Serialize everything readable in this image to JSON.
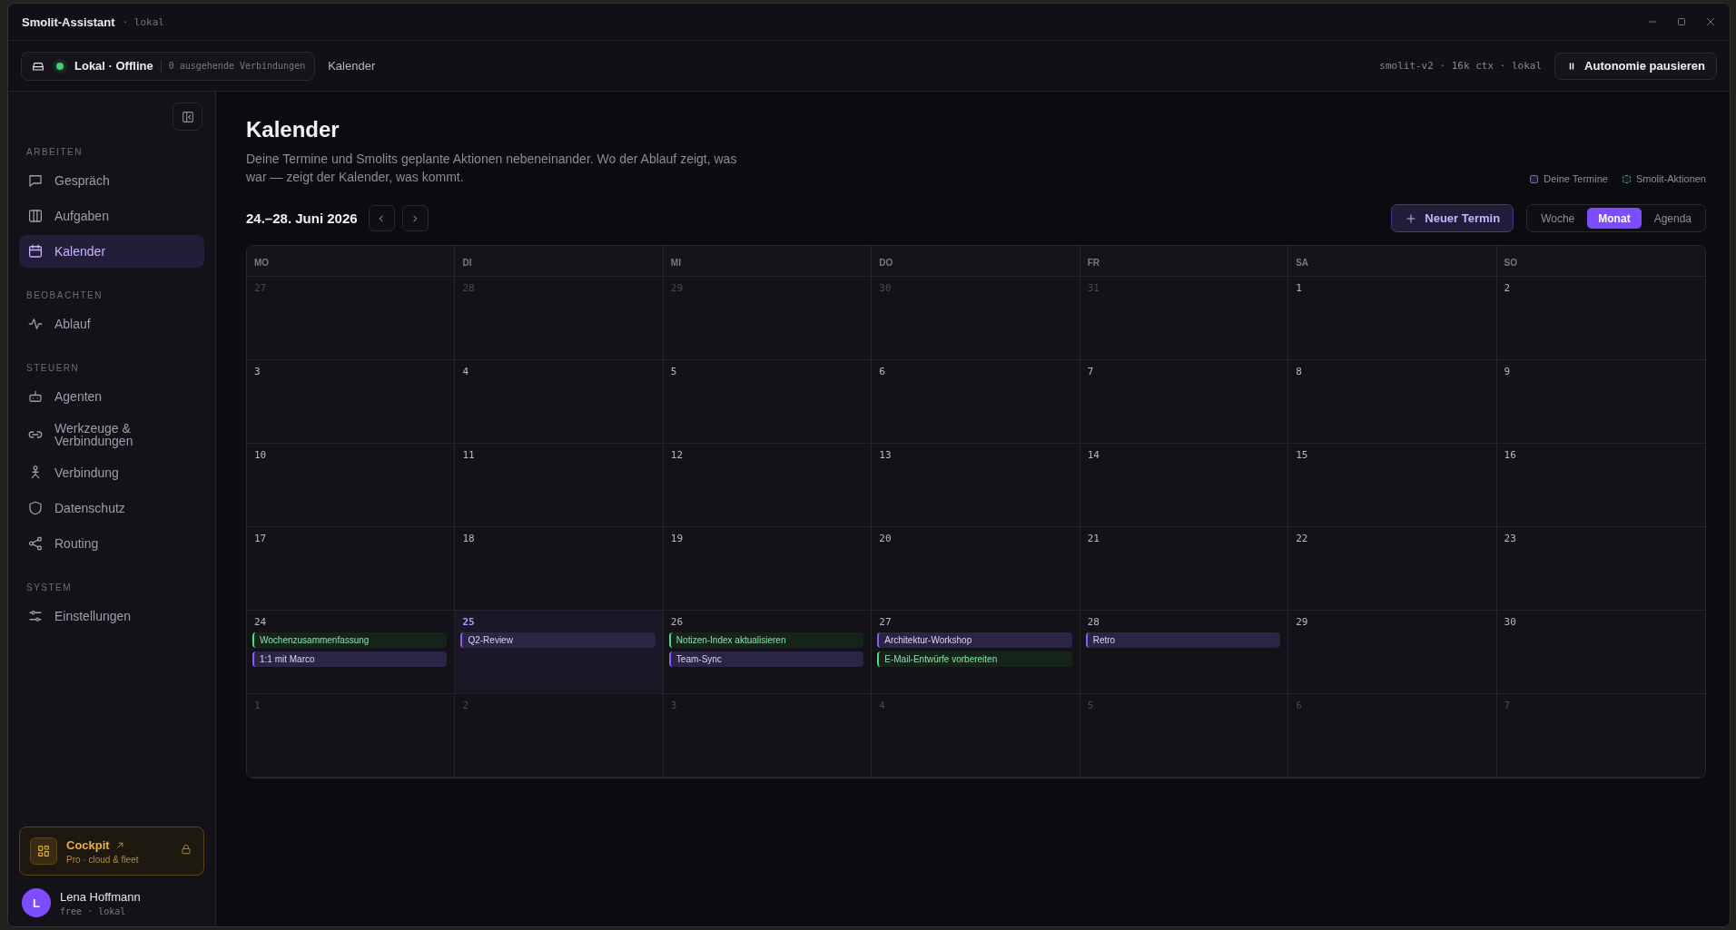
{
  "window": {
    "title": "Smolit-Assistant",
    "subtitle": "· lokal"
  },
  "topbar": {
    "status": {
      "label": "Lokal · Offline",
      "online": true,
      "connections": "0 ausgehende Verbindungen"
    },
    "breadcrumb": "Kalender",
    "model": "smolit-v2 · 16k ctx · lokal",
    "pause_button": "Autonomie pausieren"
  },
  "sidebar": {
    "sections": [
      {
        "heading": "ARBEITEN",
        "items": [
          {
            "label": "Gespräch",
            "selected": false
          },
          {
            "label": "Aufgaben",
            "selected": false
          },
          {
            "label": "Kalender",
            "selected": true
          }
        ]
      },
      {
        "heading": "BEOBACHTEN",
        "items": [
          {
            "label": "Ablauf",
            "selected": false
          }
        ]
      },
      {
        "heading": "STEUERN",
        "items": [
          {
            "label": "Agenten",
            "selected": false
          },
          {
            "label": "Werkzeuge & Verbindungen",
            "selected": false
          },
          {
            "label": "Verbindung",
            "selected": false
          },
          {
            "label": "Datenschutz",
            "selected": false
          },
          {
            "label": "Routing",
            "selected": false
          }
        ]
      },
      {
        "heading": "SYSTEM",
        "items": [
          {
            "label": "Einstellungen",
            "selected": false
          }
        ]
      }
    ],
    "cockpit": {
      "title": "Cockpit",
      "subtitle": "Pro · cloud & fleet",
      "locked": true
    },
    "user": {
      "initial": "L",
      "name": "Lena Hoffmann",
      "plan": "free · lokal"
    }
  },
  "page": {
    "title": "Kalender",
    "description": "Deine Termine und Smolits geplante Aktionen nebeneinander. Wo der Ablauf zeigt, was war — zeigt der Kalender, was kommt.",
    "range": "24.–28. Juni 2026",
    "legend": [
      {
        "kind": "user",
        "label": "Deine Termine"
      },
      {
        "kind": "smolit",
        "label": "Smolit-Aktionen"
      }
    ],
    "new_button": "Neuer Termin",
    "views": [
      {
        "label": "Woche",
        "selected": false
      },
      {
        "label": "Monat",
        "selected": true
      },
      {
        "label": "Agenda",
        "selected": false
      }
    ]
  },
  "calendar": {
    "weekdays": [
      "MO",
      "DI",
      "MI",
      "DO",
      "FR",
      "SA",
      "SO"
    ],
    "weeks": [
      [
        {
          "day": "27",
          "outside": true,
          "today": false
        },
        {
          "day": "28",
          "outside": true,
          "today": false
        },
        {
          "day": "29",
          "outside": true,
          "today": false
        },
        {
          "day": "30",
          "outside": true,
          "today": false
        },
        {
          "day": "31",
          "outside": true,
          "today": false
        },
        {
          "day": "1",
          "outside": false,
          "today": false
        },
        {
          "day": "2",
          "outside": false,
          "today": false
        }
      ],
      [
        {
          "day": "3",
          "outside": false,
          "today": false
        },
        {
          "day": "4",
          "outside": false,
          "today": false
        },
        {
          "day": "5",
          "outside": false,
          "today": false
        },
        {
          "day": "6",
          "outside": false,
          "today": false
        },
        {
          "day": "7",
          "outside": false,
          "today": false
        },
        {
          "day": "8",
          "outside": false,
          "today": false
        },
        {
          "day": "9",
          "outside": false,
          "today": false
        }
      ],
      [
        {
          "day": "10",
          "outside": false,
          "today": false
        },
        {
          "day": "11",
          "outside": false,
          "today": false
        },
        {
          "day": "12",
          "outside": false,
          "today": false
        },
        {
          "day": "13",
          "outside": false,
          "today": false
        },
        {
          "day": "14",
          "outside": false,
          "today": false
        },
        {
          "day": "15",
          "outside": false,
          "today": false
        },
        {
          "day": "16",
          "outside": false,
          "today": false
        }
      ],
      [
        {
          "day": "17",
          "outside": false,
          "today": false
        },
        {
          "day": "18",
          "outside": false,
          "today": false
        },
        {
          "day": "19",
          "outside": false,
          "today": false
        },
        {
          "day": "20",
          "outside": false,
          "today": false
        },
        {
          "day": "21",
          "outside": false,
          "today": false
        },
        {
          "day": "22",
          "outside": false,
          "today": false
        },
        {
          "day": "23",
          "outside": false,
          "today": false
        }
      ],
      [
        {
          "day": "24",
          "outside": false,
          "today": false,
          "events": [
            {
              "kind": "smolit",
              "title": "Wochenzusammenfassung"
            },
            {
              "kind": "user",
              "title": "1:1 mit Marco"
            }
          ]
        },
        {
          "day": "25",
          "outside": false,
          "today": true,
          "events": [
            {
              "kind": "user",
              "title": "Q2-Review"
            }
          ]
        },
        {
          "day": "26",
          "outside": false,
          "today": false,
          "events": [
            {
              "kind": "smolit",
              "title": "Notizen-Index aktualisieren"
            },
            {
              "kind": "user",
              "title": "Team-Sync"
            }
          ]
        },
        {
          "day": "27",
          "outside": false,
          "today": false,
          "events": [
            {
              "kind": "user",
              "title": "Architektur-Workshop"
            },
            {
              "kind": "smolit",
              "title": "E-Mail-Entwürfe vorbereiten"
            }
          ]
        },
        {
          "day": "28",
          "outside": false,
          "today": false,
          "events": [
            {
              "kind": "user",
              "title": "Retro"
            }
          ]
        },
        {
          "day": "29",
          "outside": false,
          "today": false
        },
        {
          "day": "30",
          "outside": false,
          "today": false
        }
      ],
      [
        {
          "day": "1",
          "outside": true,
          "today": false
        },
        {
          "day": "2",
          "outside": true,
          "today": false
        },
        {
          "day": "3",
          "outside": true,
          "today": false
        },
        {
          "day": "4",
          "outside": true,
          "today": false
        },
        {
          "day": "5",
          "outside": true,
          "today": false
        },
        {
          "day": "6",
          "outside": true,
          "today": false
        },
        {
          "day": "7",
          "outside": true,
          "today": false
        }
      ]
    ]
  }
}
